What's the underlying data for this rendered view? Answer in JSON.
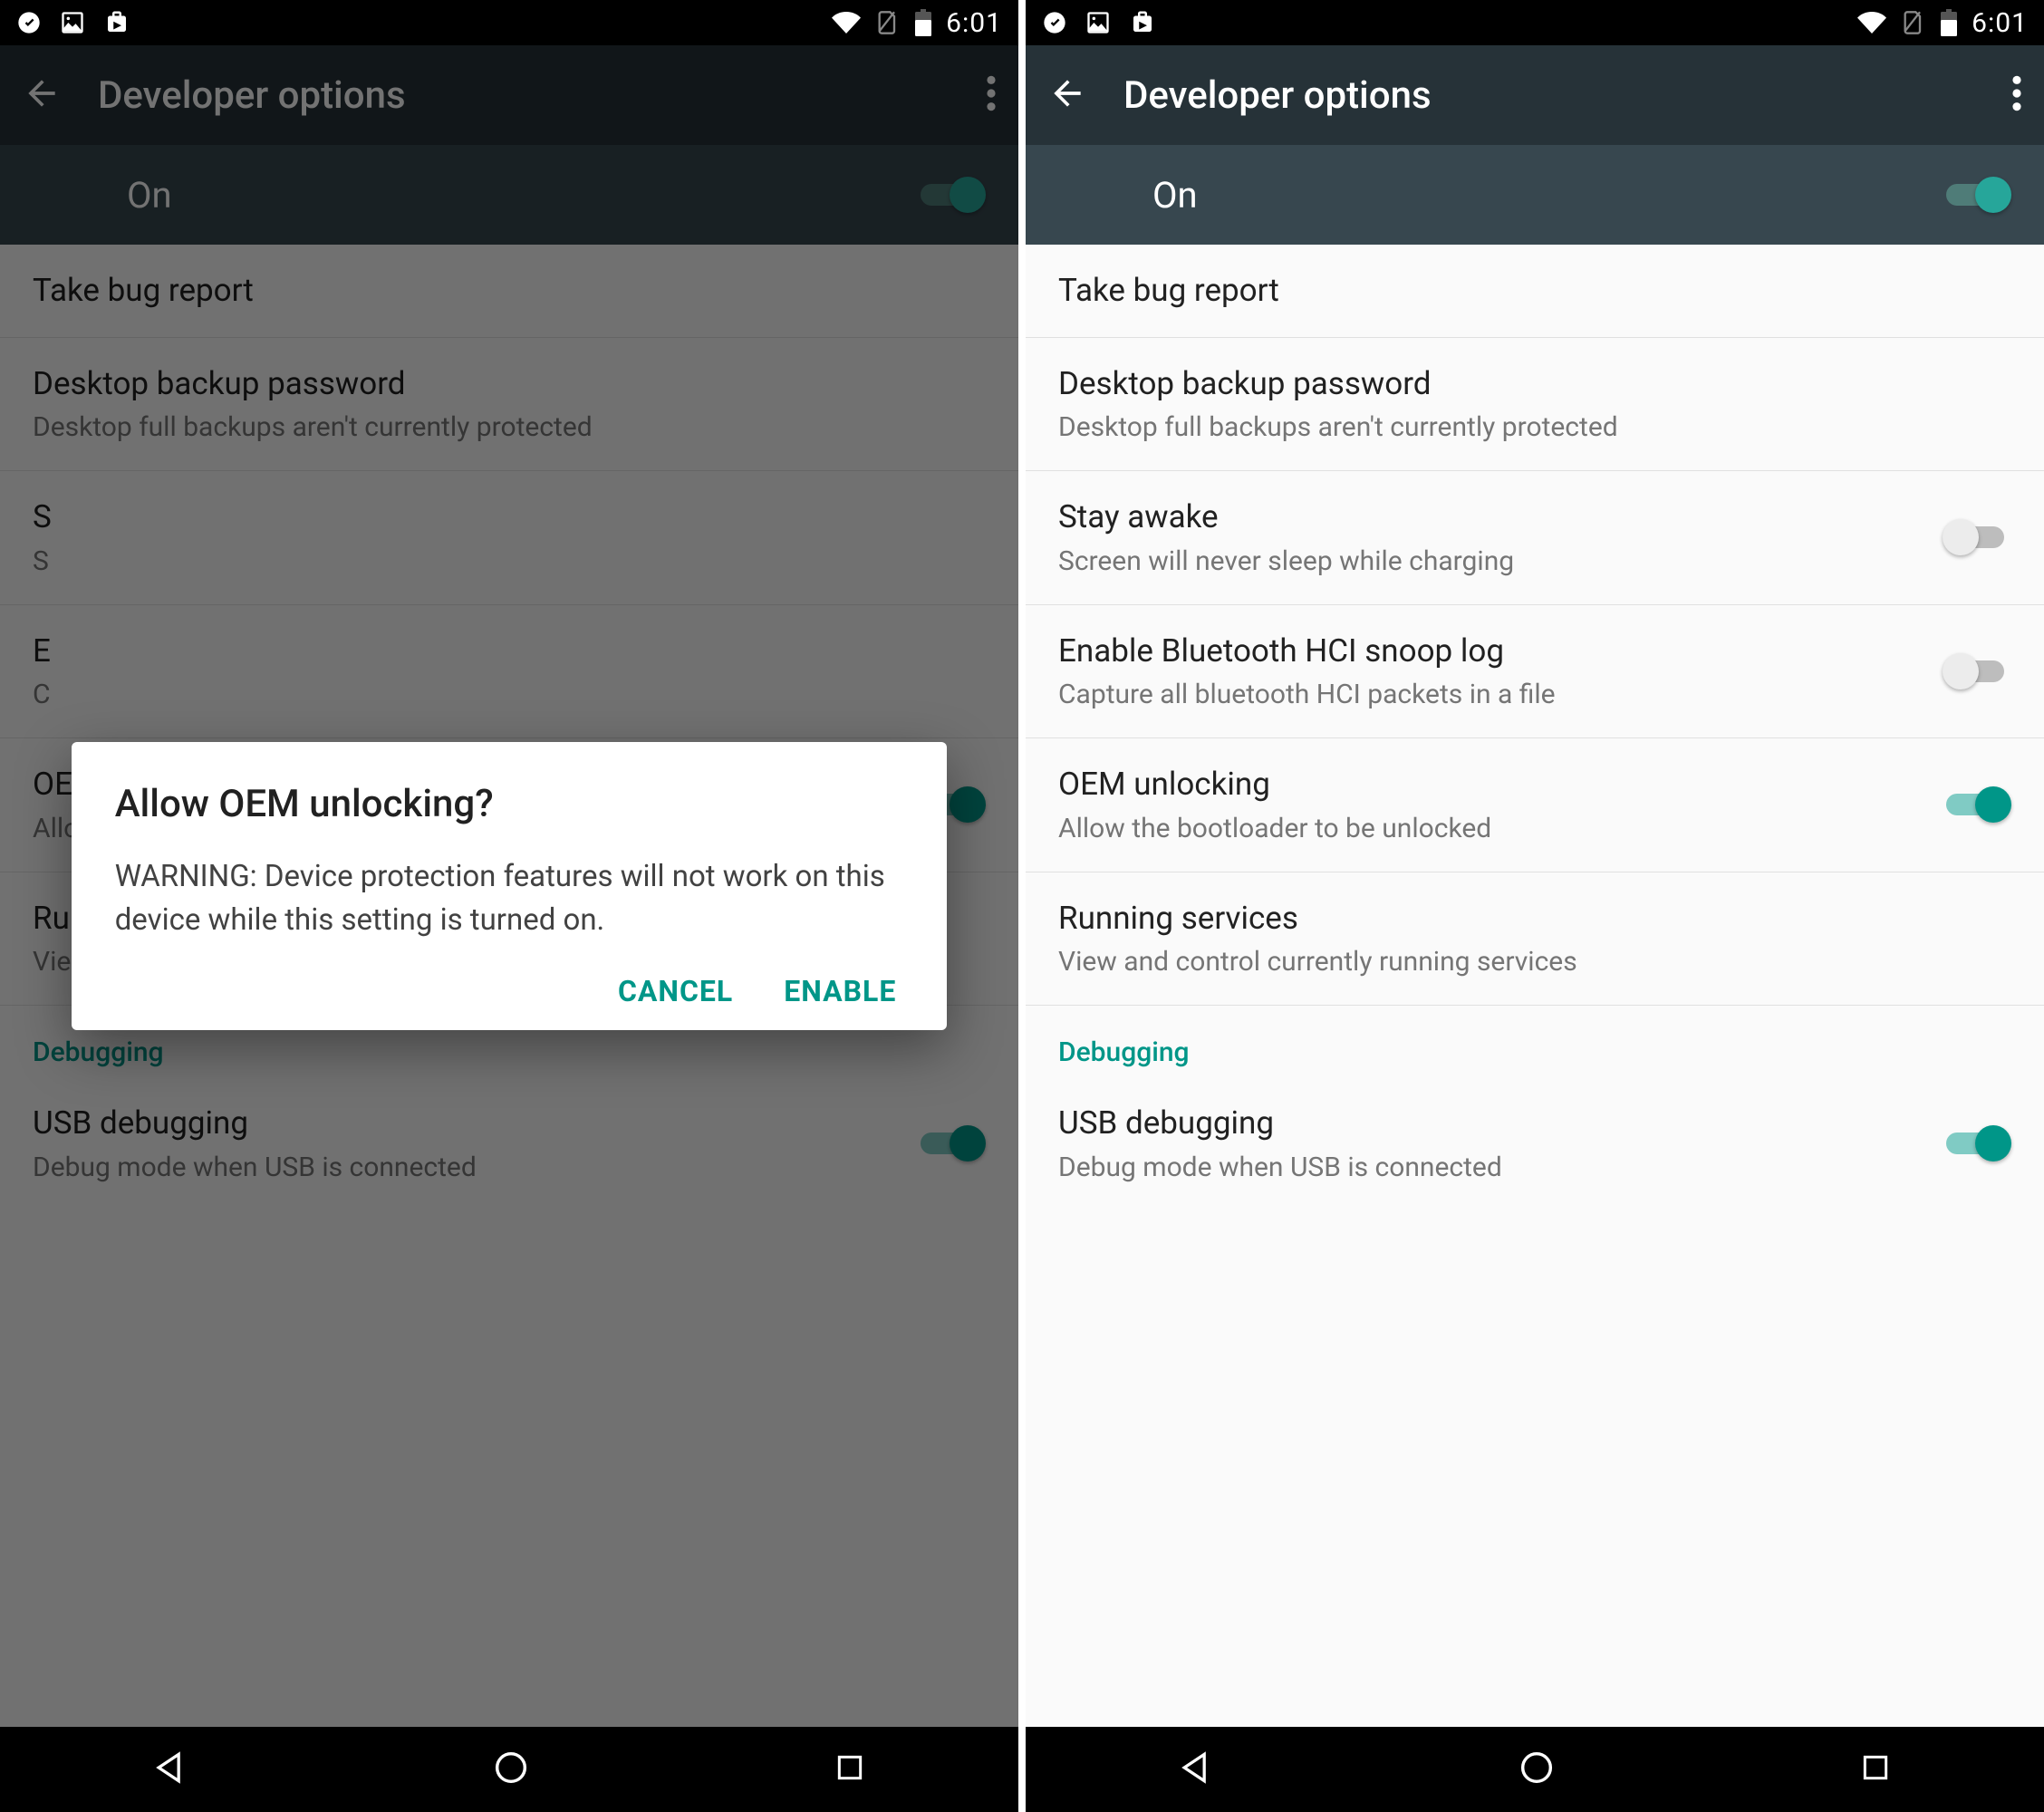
{
  "status": {
    "time": "6:01"
  },
  "appbar": {
    "title": "Developer options"
  },
  "master": {
    "label": "On"
  },
  "items": {
    "bugreport": {
      "primary": "Take bug report"
    },
    "backup": {
      "primary": "Desktop backup password",
      "secondary": "Desktop full backups aren't currently protected"
    },
    "stayawake": {
      "primary": "Stay awake",
      "secondary": "Screen will never sleep while charging"
    },
    "hci": {
      "primary": "Enable Bluetooth HCI snoop log",
      "secondary": "Capture all bluetooth HCI packets in a file"
    },
    "oem": {
      "primary": "OEM unlocking",
      "secondary": "Allow the bootloader to be unlocked"
    },
    "running": {
      "primary": "Running services",
      "secondary": "View and control currently running services"
    },
    "usb": {
      "primary": "USB debugging",
      "secondary": "Debug mode when USB is connected"
    }
  },
  "section": {
    "debugging": "Debugging"
  },
  "dialog": {
    "title": "Allow OEM unlocking?",
    "body": "WARNING: Device protection features will not work on this device while this setting is turned on.",
    "cancel": "CANCEL",
    "enable": "ENABLE"
  },
  "left": {
    "truncated1": "S",
    "truncated2": "S",
    "truncated3": "E",
    "truncated4": "C"
  }
}
